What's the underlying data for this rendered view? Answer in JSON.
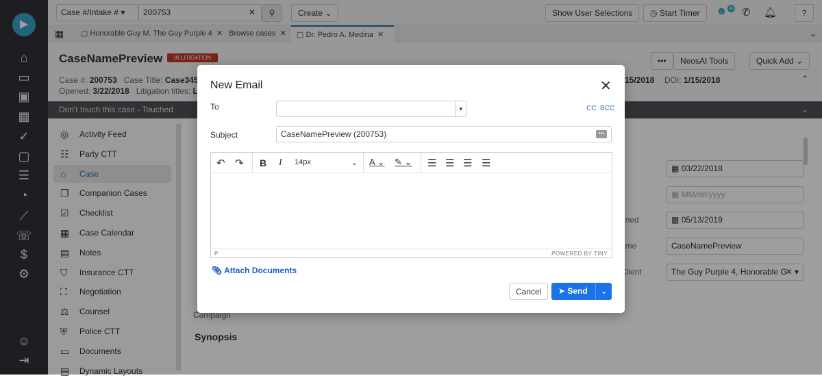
{
  "rail": {
    "icons": [
      "briefcase-icon",
      "folder-icon",
      "contacts-icon",
      "calendar-icon",
      "check-circle-icon",
      "inbox-icon",
      "message-icon",
      "gauge-icon",
      "chart-icon",
      "phone-list-icon",
      "dollar-icon",
      "gear-icon"
    ],
    "bottom": [
      "user-icon",
      "logout-icon"
    ]
  },
  "topbar": {
    "search_type": "Case #/Intake #",
    "search_value": "200753",
    "create": "Create",
    "show_user_selections": "Show User Selections",
    "start_timer": "Start Timer",
    "ai_badge": "AI"
  },
  "tabs": [
    {
      "label": "Honorable Guy M. The Guy Purple 4"
    },
    {
      "label": "Browse cases"
    },
    {
      "label": "Dr. Pedro A. Medina"
    }
  ],
  "header": {
    "title": "CaseNamePreview",
    "status": "IN LITIGATION",
    "case_no_label": "Case #:",
    "case_no": "200753",
    "case_title_label": "Case Title:",
    "case_title": "Case345",
    "opened_label": "Opened:",
    "opened": "3/22/2018",
    "litigation_label": "Litigation titles:",
    "litigation": "L",
    "date_partial": "15/2018",
    "doi_label": "DOI:",
    "doi": "1/15/2018",
    "more": "•••",
    "neosai": "NeosAI Tools",
    "quick_add": "Quick Add"
  },
  "banner": {
    "text": "Don't touch this case - Touched"
  },
  "nav": {
    "items": [
      "Activity Feed",
      "Party CTT",
      "Case",
      "Companion Cases",
      "Checklist",
      "Case Calendar",
      "Notes",
      "Insurance CTT",
      "Negotiation",
      "Counsel",
      "Police CTT",
      "Documents",
      "Dynamic Layouts"
    ],
    "active": "Case"
  },
  "main": {
    "labels_right": [
      "d",
      "",
      "gned",
      "ame",
      "Client"
    ],
    "fields": [
      "03/22/2018",
      "MM/dd/yyyy",
      "05/13/2019",
      "CaseNamePreview",
      "The Guy Purple 4, Honorable G"
    ],
    "campaign": "Campaign",
    "synopsis": "Synopsis"
  },
  "modal": {
    "title": "New Email",
    "to_label": "To",
    "to_value": "",
    "cc": "CC",
    "bcc": "BCC",
    "subject_label": "Subject",
    "subject_value": "CaseNamePreview (200753)",
    "font_size": "14px",
    "status_path": "P",
    "powered": "POWERED BY TINY",
    "attach": "Attach Documents",
    "cancel": "Cancel",
    "send": "Send",
    "accent": "#1a73e8"
  }
}
